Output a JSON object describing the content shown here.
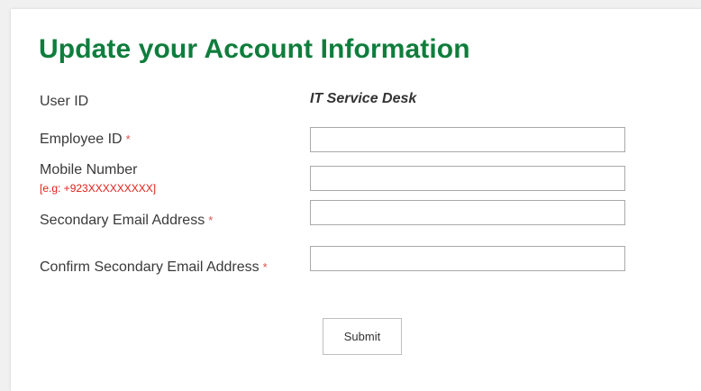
{
  "form": {
    "title": "Update your Account Information",
    "required_marker": "*",
    "user_id": {
      "label": "User ID",
      "value": "IT Service Desk"
    },
    "employee_id": {
      "label": "Employee ID",
      "value": ""
    },
    "mobile_number": {
      "label": "Mobile Number",
      "hint": "[e.g: +923XXXXXXXXX]",
      "value": ""
    },
    "secondary_email": {
      "label": "Secondary Email Address",
      "value": ""
    },
    "confirm_secondary_email": {
      "label": "Confirm Secondary Email Address",
      "value": ""
    },
    "submit_label": "Submit"
  },
  "colors": {
    "title": "#0f7d3c",
    "required": "#d9534f",
    "hint": "#e0201b"
  }
}
